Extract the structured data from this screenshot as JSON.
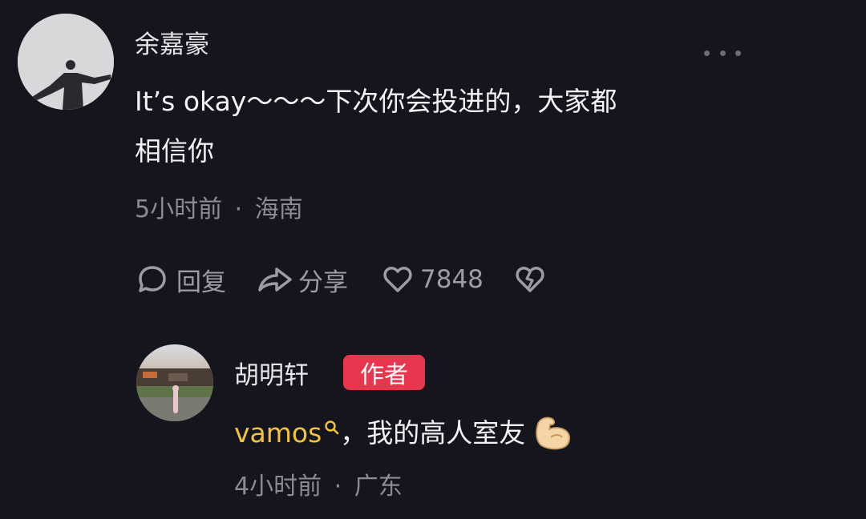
{
  "comment": {
    "username": "余嘉豪",
    "text_line1": "It’s okay～～～下次你会投进的，大家都",
    "text_line2": "相信你",
    "time": "5小时前",
    "location": "海南",
    "meta_separator": "·",
    "actions": {
      "reply_label": "回复",
      "share_label": "分享",
      "like_count": "7848"
    }
  },
  "reply": {
    "username": "胡明轩",
    "badge": "作者",
    "link_text": "vamos",
    "text": "，我的高人室友",
    "time": "4小时前",
    "location": "广东",
    "meta_separator": "·"
  },
  "colors": {
    "background": "#15151e",
    "badge": "#e8364f",
    "link": "#f2c33d",
    "meta": "#8b8b93"
  },
  "icons": [
    "more-options-icon",
    "reply-bubble-icon",
    "share-arrow-icon",
    "heart-icon",
    "broken-heart-icon",
    "search-icon",
    "flexed-biceps-emoji"
  ]
}
